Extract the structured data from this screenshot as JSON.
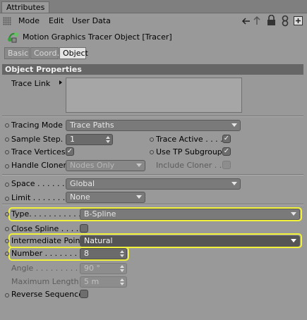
{
  "window": {
    "tab_label": "Attributes"
  },
  "menu": {
    "items": [
      "Mode",
      "Edit",
      "User Data"
    ]
  },
  "toolbar_icons": [
    "lock-icon",
    "link-icon",
    "add-panel-icon"
  ],
  "object": {
    "title": "Motion Graphics Tracer Object [Tracer]",
    "icon": "tracer-object-icon"
  },
  "tabs": [
    {
      "label": "Basic",
      "active": false
    },
    {
      "label": "Coord.",
      "active": false
    },
    {
      "label": "Object",
      "active": true
    }
  ],
  "section": {
    "title": "Object Properties"
  },
  "fields": {
    "trace_link": {
      "label": "Trace Link"
    },
    "tracing_mode": {
      "label": "Tracing Mode",
      "value": "Trace Paths"
    },
    "sample_step": {
      "label": "Sample Step.",
      "value": "1"
    },
    "trace_active": {
      "label": "Trace Active . . . .",
      "checked": true
    },
    "trace_vertices": {
      "label": "Trace Vertices",
      "checked": true
    },
    "use_tp_subgroups": {
      "label": "Use TP Subgroups",
      "checked": true
    },
    "handle_cloners": {
      "label": "Handle Cloners",
      "value": "Nodes Only"
    },
    "include_cloner": {
      "label": "Include Cloner . . .",
      "checked": false
    },
    "space": {
      "label": "Space . . . . . . .",
      "value": "Global"
    },
    "limit": {
      "label": "Limit . . . . . . . .",
      "value": "None"
    },
    "type": {
      "label": "Type. . . . . . . . . . . . .",
      "value": "B-Spline"
    },
    "close_spline": {
      "label": "Close Spline . . . . . .",
      "checked": false
    },
    "intermediate_points": {
      "label": "Intermediate Points",
      "value": "Natural"
    },
    "number": {
      "label": "Number . . . . . . . . .",
      "value": "8"
    },
    "angle": {
      "label": "Angle . . . . . . . . . . . .",
      "value": "90 °"
    },
    "maximum_length": {
      "label": "Maximum Length . . .",
      "value": "5 m"
    },
    "reverse_sequence": {
      "label": "Reverse Sequence",
      "checked": false
    }
  },
  "colors": {
    "highlight": "#f2f23a",
    "panel": "#999999",
    "header": "#666666"
  }
}
